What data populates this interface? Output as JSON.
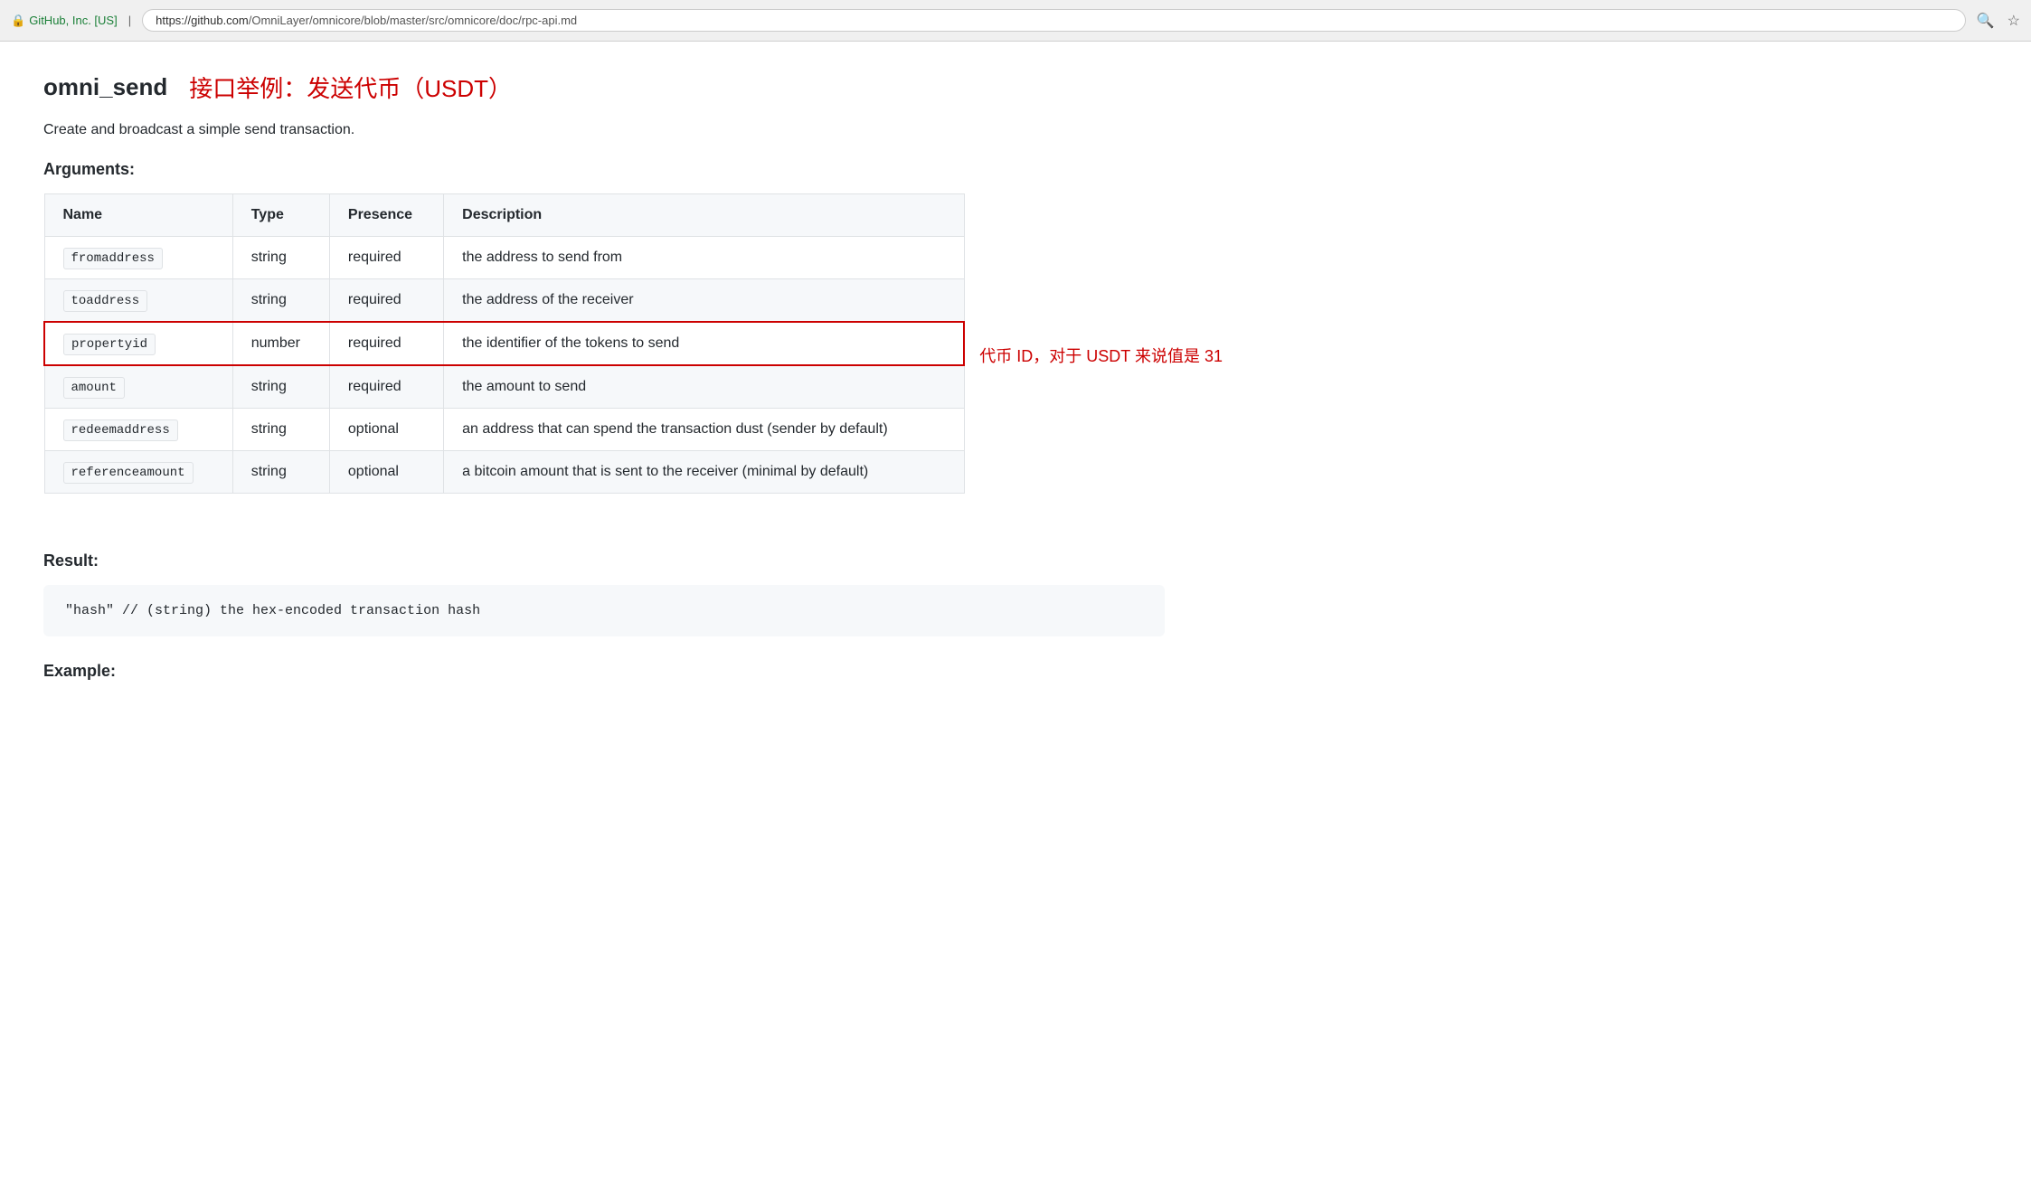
{
  "browser": {
    "security_label": "GitHub, Inc. [US]",
    "url_base": "https://github.com",
    "url_path": "/OmniLayer/omnicore/blob/master/src/omnicore/doc/rpc-api.md",
    "full_url": "https://github.com/OmniLayer/omnicore/blob/master/src/omnicore/doc/rpc-api.md"
  },
  "page": {
    "api_name": "omni_send",
    "chinese_title": "接口举例：发送代币（USDT）",
    "description": "Create and broadcast a simple send transaction.",
    "arguments_label": "Arguments:",
    "result_label": "Result:",
    "example_label": "Example:"
  },
  "table": {
    "headers": [
      "Name",
      "Type",
      "Presence",
      "Description"
    ],
    "rows": [
      {
        "name": "fromaddress",
        "type": "string",
        "presence": "required",
        "description": "the address to send from",
        "highlighted": false
      },
      {
        "name": "toaddress",
        "type": "string",
        "presence": "required",
        "description": "the address of the receiver",
        "highlighted": false
      },
      {
        "name": "propertyid",
        "type": "number",
        "presence": "required",
        "description": "the identifier of the tokens to send",
        "highlighted": true,
        "annotation": "代币 ID，对于 USDT 来说值是 31"
      },
      {
        "name": "amount",
        "type": "string",
        "presence": "required",
        "description": "the amount to send",
        "highlighted": false
      },
      {
        "name": "redeemaddress",
        "type": "string",
        "presence": "optional",
        "description": "an address that can spend the transaction dust (sender by default)",
        "highlighted": false
      },
      {
        "name": "referenceamount",
        "type": "string",
        "presence": "optional",
        "description": "a bitcoin amount that is sent to the receiver (minimal by default)",
        "highlighted": false
      }
    ]
  },
  "result": {
    "code": "\"hash\"  // (string) the hex-encoded transaction hash"
  }
}
